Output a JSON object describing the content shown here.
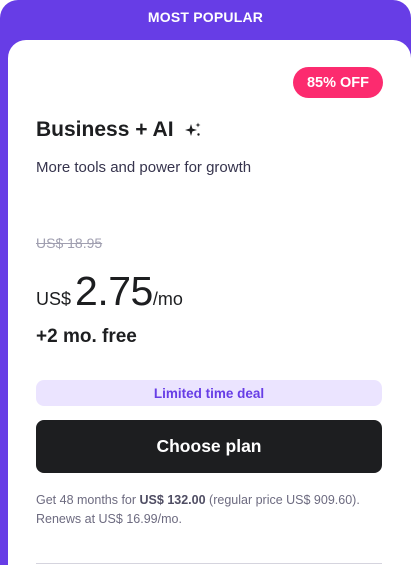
{
  "banner": {
    "label": "MOST POPULAR"
  },
  "plan": {
    "discount_badge": "85% OFF",
    "title": "Business + AI",
    "title_icon": "sparkle-icon",
    "subtitle": "More tools and power for growth",
    "old_price": "US$ 18.95",
    "currency": "US$",
    "price": "2.75",
    "period": "/mo",
    "bonus": "+2 mo. free",
    "deal_label": "Limited time deal",
    "cta_label": "Choose plan",
    "fine_print": {
      "prefix": "Get 48 months for ",
      "total": "US$ 132.00",
      "suffix": " (regular price US$ 909.60). Renews at US$ 16.99/mo."
    }
  },
  "colors": {
    "brand_purple": "#673de6",
    "discount_pink": "#fc2b6f",
    "deal_bg": "#ebe4ff",
    "button_dark": "#1d1e20"
  }
}
